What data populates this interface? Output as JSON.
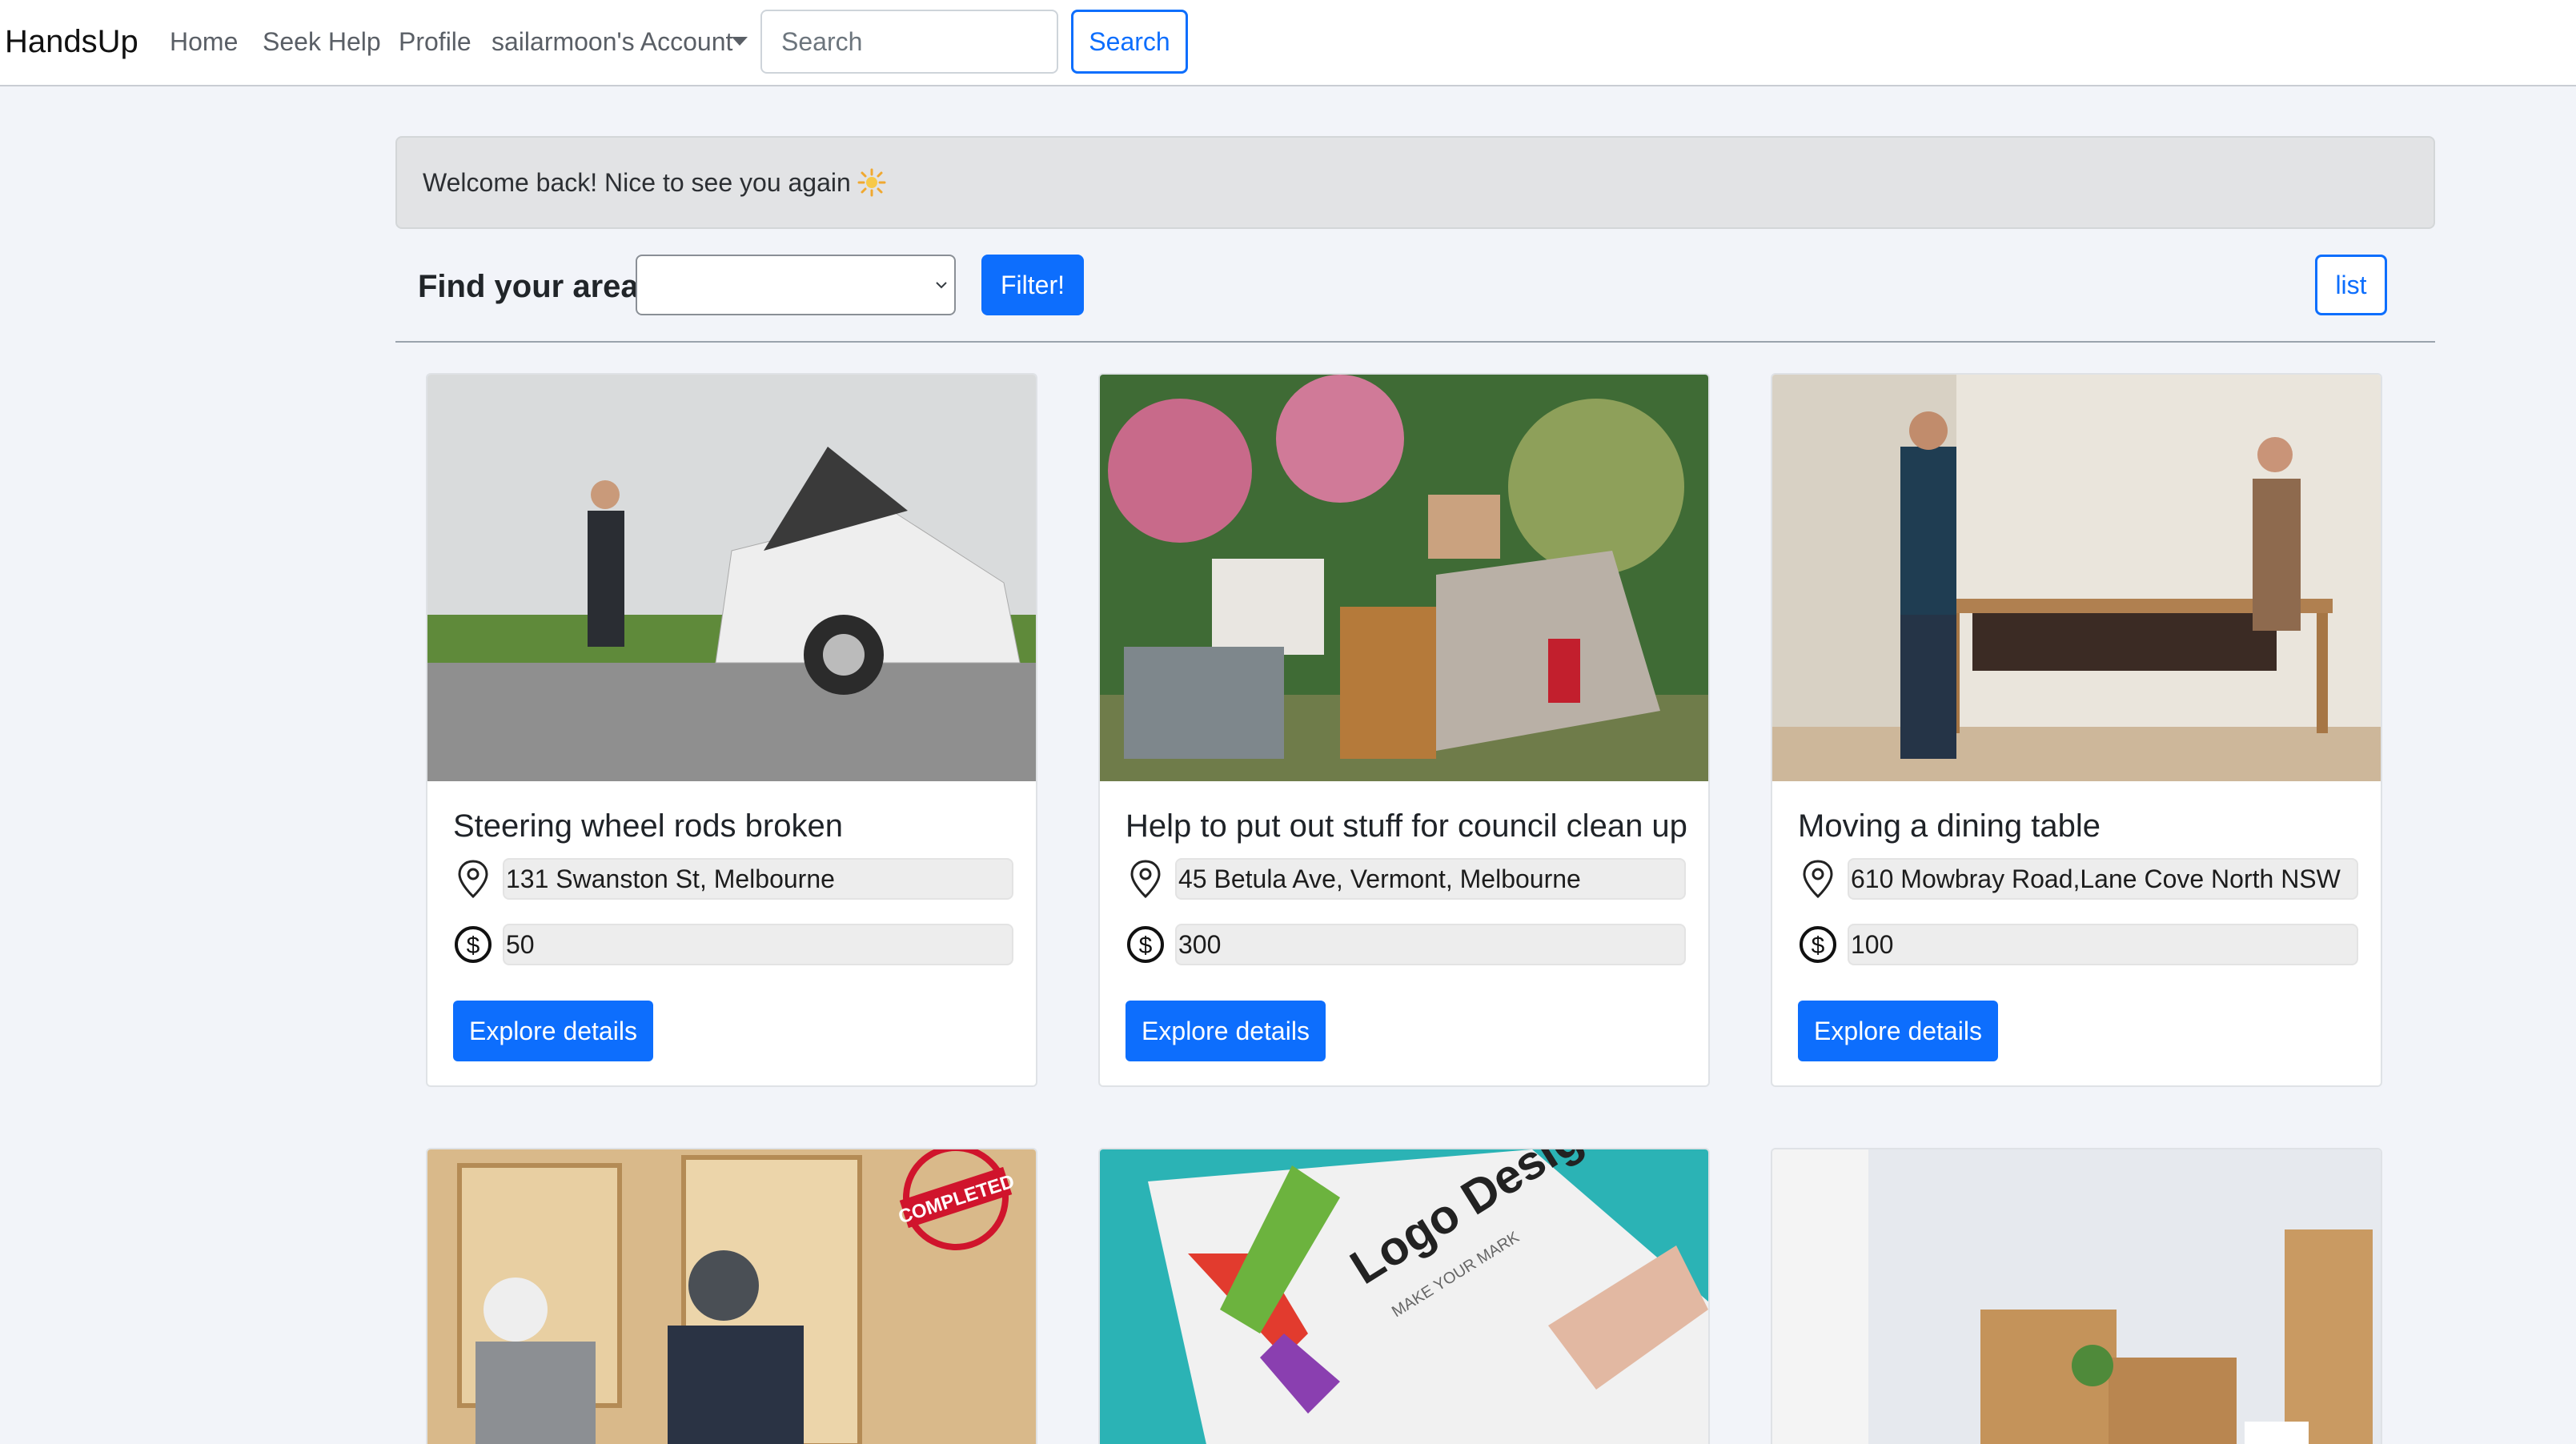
{
  "navbar": {
    "brand": "HandsUp",
    "links": [
      "Home",
      "Seek Help",
      "Profile"
    ],
    "account": "sailarmoon's Account",
    "search_placeholder": "Search",
    "search_button": "Search"
  },
  "alert": {
    "message": "Welcome back! Nice to see you again",
    "icon": "sun-icon"
  },
  "filter": {
    "label": "Find your area",
    "selected_area": "",
    "filter_button": "Filter!",
    "view_toggle": "list"
  },
  "cards": [
    {
      "title": "Steering wheel rods broken",
      "location": "131 Swanston St, Melbourne",
      "price": "50",
      "button": "Explore details",
      "image": "car-breakdown-photo",
      "completed": false
    },
    {
      "title": "Help to put out stuff for council clean up",
      "location": "45 Betula Ave, Vermont, Melbourne",
      "price": "300",
      "button": "Explore details",
      "image": "council-clean-up-photo",
      "completed": false
    },
    {
      "title": "Moving a dining table",
      "location": "610 Mowbray Road,Lane Cove North NSW",
      "price": "100",
      "button": "Explore details",
      "image": "moving-table-photo",
      "completed": false
    },
    {
      "title": "",
      "location": "",
      "price": "",
      "button": "",
      "image": "cabinet-installation-photo",
      "completed": true,
      "stamp_text": "COMPLETED"
    },
    {
      "title": "",
      "location": "",
      "price": "",
      "button": "",
      "image": "logo-design-photo",
      "completed": false,
      "image_text": "Logo Design",
      "image_subtext": "MAKE YOUR MARK"
    },
    {
      "title": "",
      "location": "",
      "price": "",
      "button": "",
      "image": "moving-boxes-photo",
      "completed": false
    }
  ],
  "colors": {
    "primary": "#0d6efd",
    "page_bg": "#f2f4f9",
    "alert_bg": "#e2e3e5"
  }
}
